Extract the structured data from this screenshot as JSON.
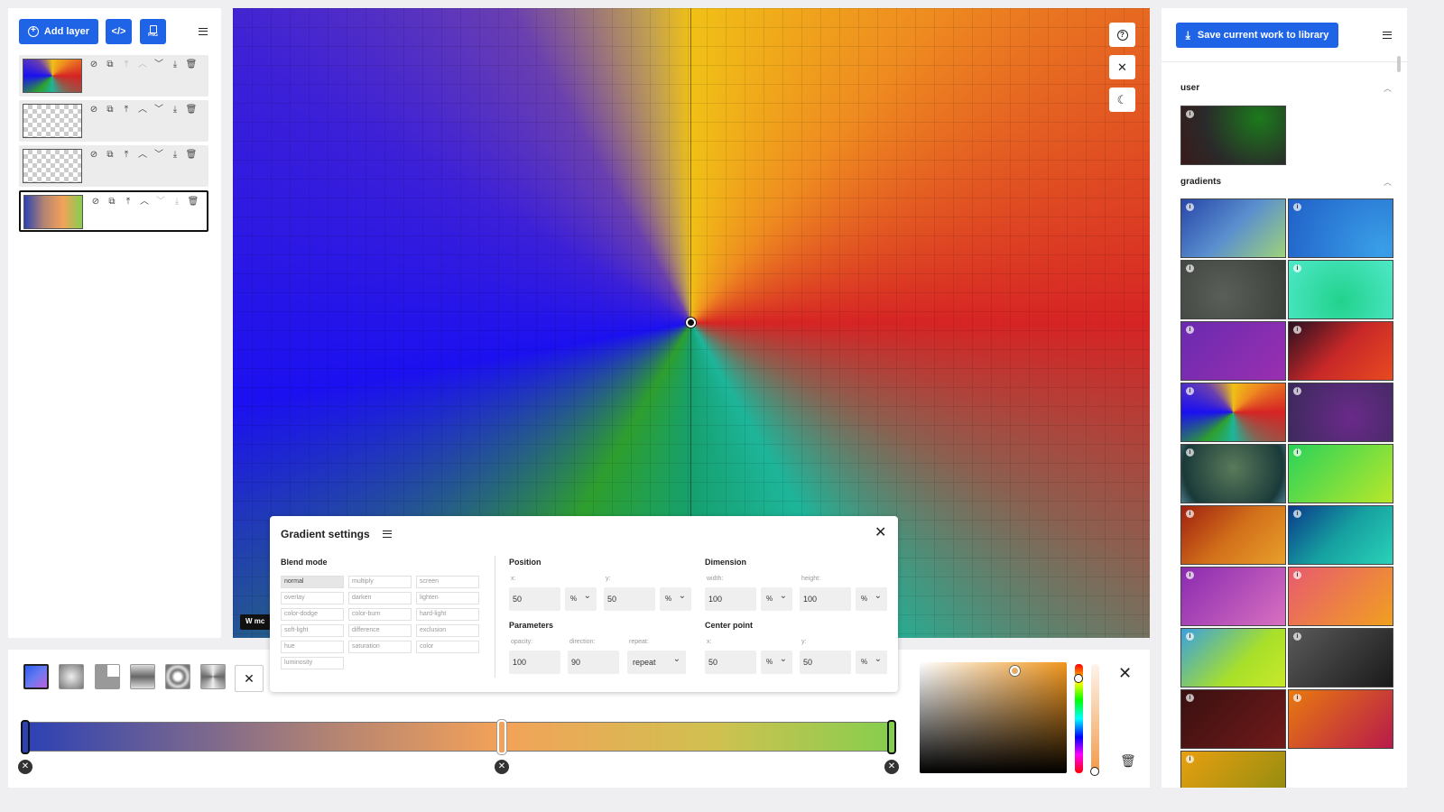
{
  "toolbar": {
    "add_layer_label": "Add layer",
    "code_label": "</>",
    "png_label": "PNG"
  },
  "layers": [
    {
      "thumb": "conic-gradient(from 0deg at 50% 50%, #f0c016, #ef8b20, #d62424, #8b6050, #1db59a, #2e9f2e, #1b10f0, #6a3fb0, #f0c016)",
      "transparent": false,
      "active": false
    },
    {
      "thumb": "",
      "transparent": true,
      "active": false
    },
    {
      "thumb": "",
      "transparent": true,
      "active": false
    },
    {
      "thumb": "linear-gradient(90deg, #2c41b4, #b28373, #f3a259, #86ce4e)",
      "transparent": false,
      "active": true
    }
  ],
  "canvas": {
    "watermark_text": "W mc"
  },
  "bottom": {
    "stops": [
      {
        "percent": 0,
        "color": "#2c41b4"
      },
      {
        "percent": 55,
        "color": "#f3a259"
      },
      {
        "percent": 100,
        "color": "#86ce4e"
      }
    ],
    "picker": {
      "hue_color": "#f0961e",
      "hue_level": 0.13,
      "alpha_level": 0.98
    }
  },
  "settings": {
    "title": "Gradient settings",
    "blend_label": "Blend mode",
    "blend_modes": [
      "normal",
      "multiply",
      "screen",
      "overlay",
      "darken",
      "lighten",
      "color-dodge",
      "color-burn",
      "hard-light",
      "soft-light",
      "difference",
      "exclusion",
      "hue",
      "saturation",
      "color",
      "luminosity"
    ],
    "selected_blend": "normal",
    "position_label": "Position",
    "x_label": "x:",
    "y_label": "y:",
    "x_value": "50",
    "x_unit": "%",
    "y_value": "50",
    "y_unit": "%",
    "dimension_label": "Dimension",
    "width_label": "width:",
    "height_label": "height:",
    "width_value": "100",
    "width_unit": "%",
    "height_value": "100",
    "height_unit": "%",
    "parameters_label": "Parameters",
    "opacity_label": "opacity:",
    "opacity_value": "100",
    "direction_label": "direction:",
    "direction_value": "90",
    "repeat_label": "repeat:",
    "repeat_value": "repeat",
    "center_label": "Center point",
    "cx_label": "x:",
    "cx_value": "50",
    "cx_unit": "%",
    "cy_label": "y:",
    "cy_value": "50",
    "cy_unit": "%"
  },
  "library": {
    "save_label": "Save current work to library",
    "user_section": "user",
    "gradients_section": "gradients",
    "user_swatches": [
      "radial-gradient(circle at 75% 20%, #1c7a1c, #2a2a2a 60%, #3a1a1a)"
    ],
    "gradient_swatches": [
      "linear-gradient(135deg, #2746a8, #5a8fcf 50%, #9ed27a)",
      "radial-gradient(circle at 90% 90%, #3aa0e8, #2060c8)",
      "radial-gradient(circle at 40% 60%, #5a5f5a, #3a3f3a)",
      "radial-gradient(circle at 50% 70%, #22d28c, #4ee8c8)",
      "linear-gradient(135deg, #6a2ab0, #9a30b0)",
      "linear-gradient(135deg, #2a1020, #c82828, #e84a20)",
      "conic-gradient(from 0deg at 50% 50%, #f0c016, #ef8b20, #d62424, #8b6050, #1db59a, #2e9f2e, #1b10f0, #6a3fb0, #f0c016)",
      "radial-gradient(circle at 60% 60%, #6a2a8a, #3a2a5a)",
      "radial-gradient(circle at 50% 40%, #5a7a5a, #1a3a3a 80%, #4a7a8a)",
      "linear-gradient(135deg, #2ad25a, #b8e82a)",
      "linear-gradient(135deg, #a02010, #d2701a, #e8a02a)",
      "linear-gradient(135deg, #0a3a8a, #16a0a0, #2ad2b8)",
      "linear-gradient(135deg, #8a2ab0, #d870c0)",
      "linear-gradient(135deg, #e85a70, #f0a020)",
      "linear-gradient(135deg, #3aa0e0, #a8e02a 60%, #c8e82a)",
      "linear-gradient(135deg, #5a5a5a, #1a1a1a)",
      "linear-gradient(135deg, #3a1010, #701a1a)",
      "linear-gradient(135deg, #e87a10, #b81a4a)",
      "linear-gradient(135deg, #e8a010, #8a8a10)"
    ]
  }
}
